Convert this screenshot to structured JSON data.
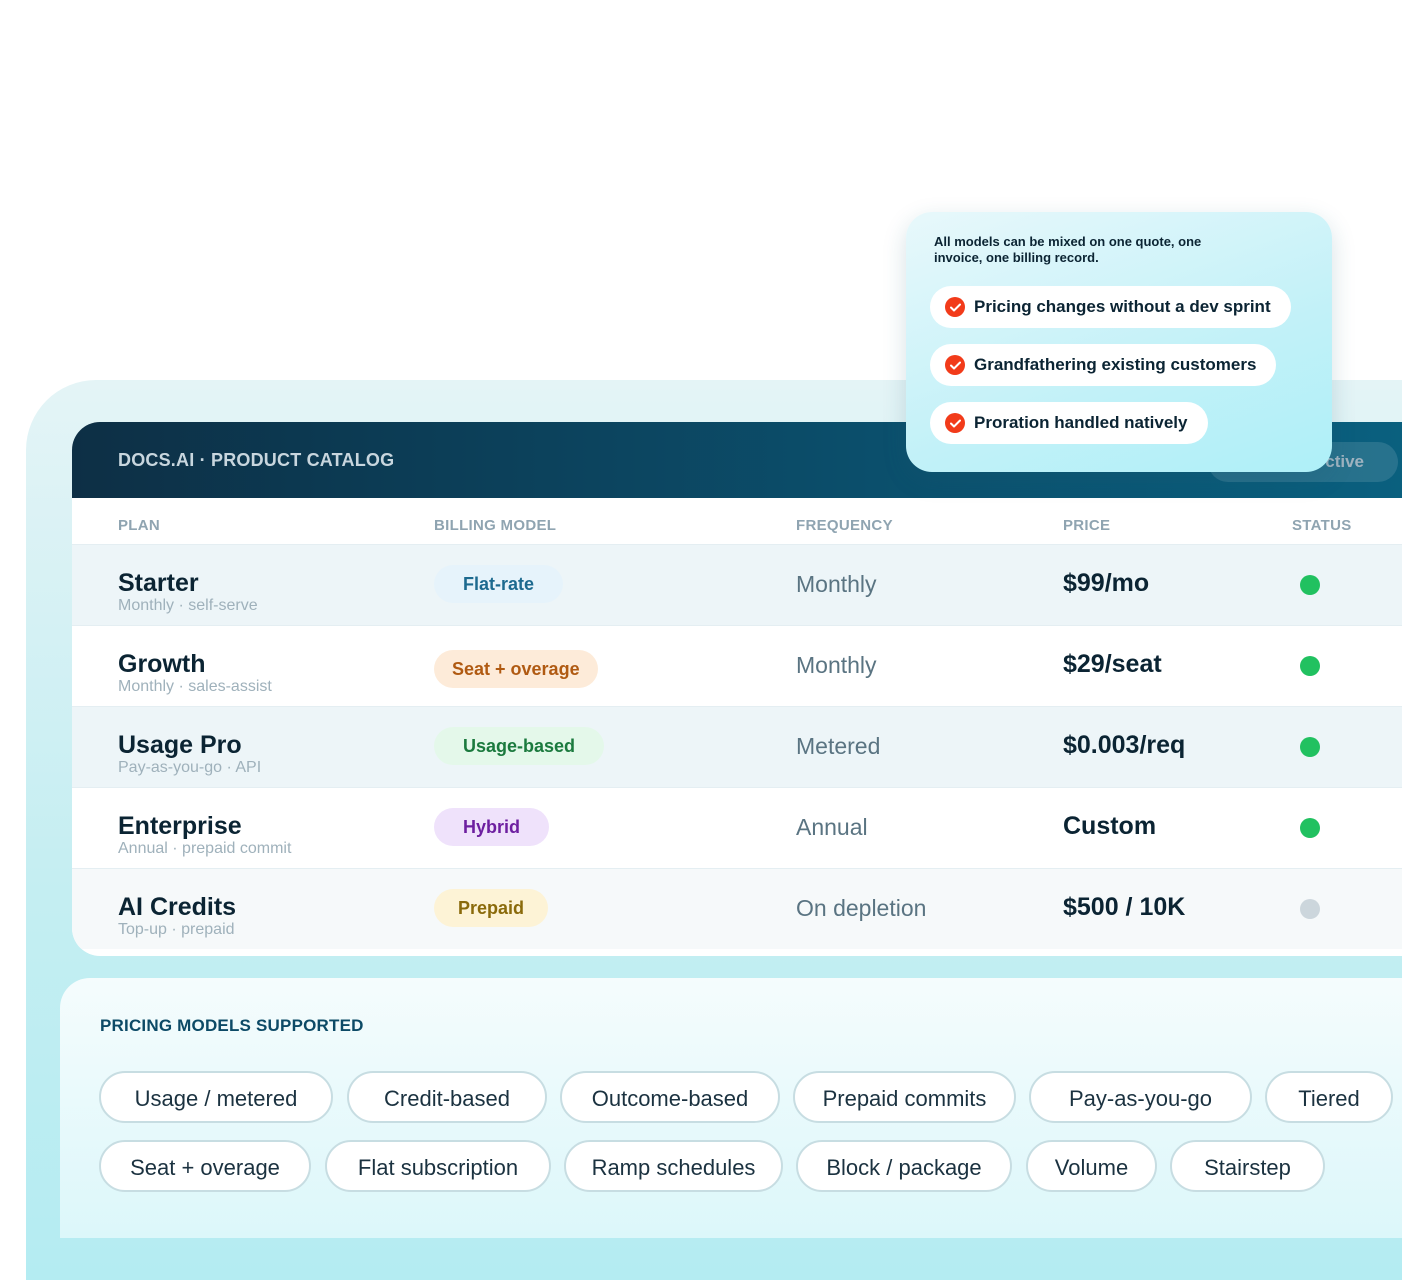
{
  "catalog": {
    "title": "DOCS.AI · PRODUCT CATALOG",
    "header_pill": "ctive",
    "columns": {
      "plan": "PLAN",
      "billing_model": "BILLING MODEL",
      "frequency": "FREQUENCY",
      "price": "PRICE",
      "status": "STATUS"
    },
    "rows": [
      {
        "name": "Starter",
        "sub": "Monthly · self-serve",
        "badge": "Flat-rate",
        "frequency": "Monthly",
        "price": "$99/mo",
        "status": "active"
      },
      {
        "name": "Growth",
        "sub": "Monthly · sales-assist",
        "badge": "Seat + overage",
        "frequency": "Monthly",
        "price": "$29/seat",
        "status": "active"
      },
      {
        "name": "Usage Pro",
        "sub": "Pay-as-you-go · API",
        "badge": "Usage-based",
        "frequency": "Metered",
        "price": "$0.003/req",
        "status": "active"
      },
      {
        "name": "Enterprise",
        "sub": "Annual · prepaid commit",
        "badge": "Hybrid",
        "frequency": "Annual",
        "price": "Custom",
        "status": "active"
      },
      {
        "name": "AI Credits",
        "sub": "Top-up · prepaid",
        "badge": "Prepaid",
        "frequency": "On depletion",
        "price": "$500 / 10K",
        "status": "inactive"
      }
    ]
  },
  "callout": {
    "text": "All models can be mixed on one quote, one invoice, one billing record.",
    "items": [
      "Pricing changes without a dev sprint",
      "Grandfathering existing customers",
      "Proration handled natively"
    ],
    "icon": "check-circle-icon"
  },
  "models": {
    "title": "PRICING MODELS SUPPORTED",
    "row1": [
      "Usage / metered",
      "Credit-based",
      "Outcome-based",
      "Prepaid commits",
      "Pay-as-you-go",
      "Tiered"
    ],
    "row2": [
      "Seat + overage",
      "Flat subscription",
      "Ramp schedules",
      "Block / package",
      "Volume",
      "Stairstep"
    ]
  },
  "colors": {
    "status_active": "#21c160",
    "status_inactive": "#ccd6dc",
    "check_accent": "#f23b1a",
    "badge_flat_bg": "#e6f3fb",
    "badge_flat_fg": "#1d6a8f",
    "badge_seat_bg": "#fdebd9",
    "badge_seat_fg": "#b05a12",
    "badge_usage_bg": "#e4f8ea",
    "badge_usage_fg": "#1b7a3e",
    "badge_hybrid_bg": "#efe2fb",
    "badge_hybrid_fg": "#6d1fa0",
    "badge_prepaid_bg": "#fdf3d6",
    "badge_prepaid_fg": "#8a6a0b"
  }
}
